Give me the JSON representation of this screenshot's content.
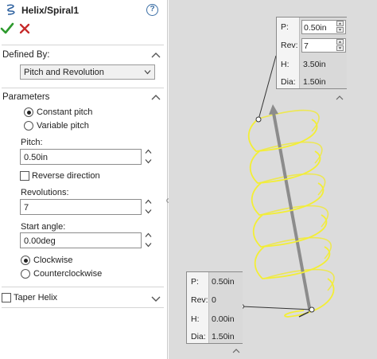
{
  "header": {
    "title": "Helix/Spiral1",
    "help_glyph": "?",
    "ok_icon": "check-icon",
    "cancel_icon": "x-icon"
  },
  "defined_by": {
    "heading": "Defined By:",
    "selected": "Pitch and Revolution"
  },
  "parameters": {
    "heading": "Parameters",
    "pitch_mode_options": [
      {
        "label": "Constant pitch",
        "selected": true
      },
      {
        "label": "Variable pitch",
        "selected": false
      }
    ],
    "pitch_label": "Pitch:",
    "pitch_value": "0.50in",
    "reverse_label": "Reverse direction",
    "reverse_checked": false,
    "revolutions_label": "Revolutions:",
    "revolutions_value": "7",
    "start_angle_label": "Start angle:",
    "start_angle_value": "0.00deg",
    "direction_options": [
      {
        "label": "Clockwise",
        "selected": true
      },
      {
        "label": "Counterclockwise",
        "selected": false
      }
    ]
  },
  "taper": {
    "label": "Taper Helix",
    "checked": false
  },
  "callout_top": {
    "rows": [
      {
        "key": "P:",
        "value": "0.50in"
      },
      {
        "key": "Rev:",
        "value": "7"
      },
      {
        "key": "H:",
        "value": "3.50in"
      },
      {
        "key": "Dia:",
        "value": "1.50in"
      }
    ]
  },
  "callout_bottom": {
    "rows": [
      {
        "key": "P:",
        "value": "0.50in"
      },
      {
        "key": "Rev:",
        "value": "0"
      },
      {
        "key": "H:",
        "value": "0.00in"
      },
      {
        "key": "Dia:",
        "value": "1.50in"
      }
    ]
  },
  "colors": {
    "helix": "#f0ea3c",
    "accent_ok": "#2e9a2e",
    "accent_cancel": "#c62a2a",
    "viewport_bg": "#dcdcdc"
  }
}
